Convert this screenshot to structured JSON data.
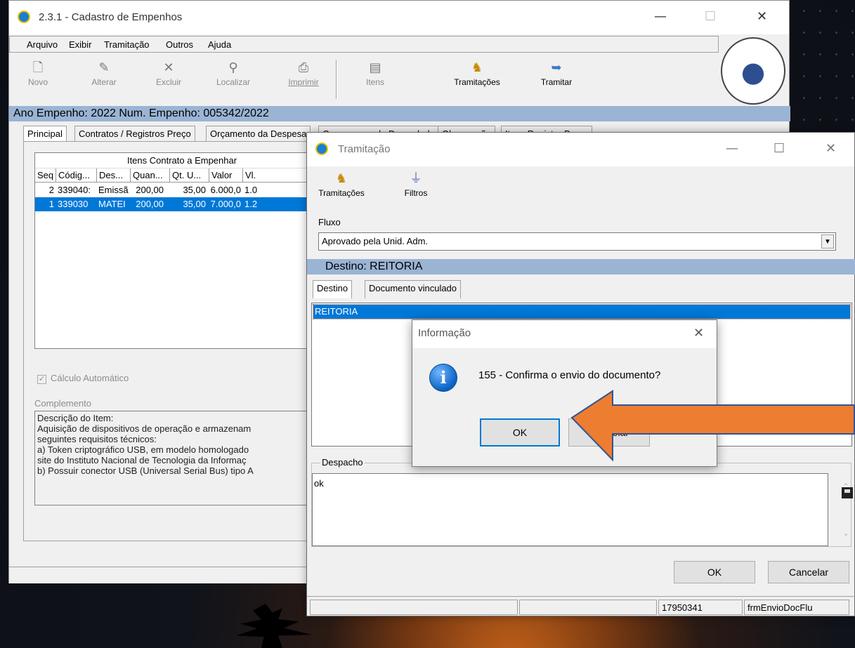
{
  "main_window": {
    "title": "2.3.1 - Cadastro de Empenhos",
    "minimize": "—",
    "maximize": "☐",
    "close": "✕",
    "menu": [
      "Arquivo",
      "Exibir",
      "Tramitação",
      "Outros",
      "Ajuda"
    ],
    "toolbar": {
      "novo": "Novo",
      "alterar": "Alterar",
      "excluir": "Excluir",
      "localizar": "Localizar",
      "imprimir": "Imprimir",
      "itens": "Itens",
      "tramitacoes": "Tramitações",
      "tramitar": "Tramitar"
    },
    "info_bar": "Ano Empenho:  2022   Num. Empenho:  005342/2022",
    "tabs": [
      "Principal",
      "Contratos / Registros Preço",
      "Orçamento da Despesa",
      "Cronograma de Desembolso",
      "Observação",
      "Itens Registro Preço"
    ],
    "grid": {
      "title": "Itens Contrato a Empenhar",
      "columns": [
        "Seq",
        "Códig...",
        "Des...",
        "Quan...",
        "Qt. U...",
        "Valor",
        "Vl."
      ],
      "rows": [
        [
          "2",
          "339040:",
          "Emissã",
          "200,00",
          "35,00",
          "6.000,0",
          "1.0"
        ],
        [
          "1",
          "339030",
          "MATEI",
          "200,00",
          "35,00",
          "7.000,0",
          "1.2"
        ]
      ]
    },
    "calculo_automatico": "Cálculo Automático",
    "complemento_label": "Complemento",
    "complemento_text": [
      "Descrição do Item:",
      "Aquisição de dispositivos de operação e armazenam",
      "seguintes requisitos técnicos:",
      "a) Token criptográfico USB, em modelo homologado",
      "site do Instituto Nacional de Tecnologia da Informaç",
      "b) Possuir conector USB (Universal Serial Bus) tipo A"
    ]
  },
  "tramitacao_window": {
    "title": "Tramitação",
    "minimize": "—",
    "maximize": "☐",
    "close": "✕",
    "toolbar": {
      "tramitacoes": "Tramitações",
      "filtros": "Filtros"
    },
    "fluxo_label": "Fluxo",
    "fluxo_value": "Aprovado pela Unid. Adm.",
    "destino_bar": "Destino: REITORIA",
    "tabs": [
      "Destino",
      "Documento vinculado"
    ],
    "destino_selected": "REITORIA",
    "despacho_label": "Despacho",
    "despacho_value": "ok",
    "ok_button": "OK",
    "cancel_button": "Cancelar",
    "status": [
      "",
      "",
      "17950341",
      "frmEnvioDocFlu"
    ]
  },
  "dialog": {
    "title": "Informação",
    "close": "✕",
    "message": "155 - Confirma o envio do documento?",
    "ok_button": "OK",
    "cancel_button": "Cancelar"
  },
  "annotation_arrow_color": "#ed7d31"
}
